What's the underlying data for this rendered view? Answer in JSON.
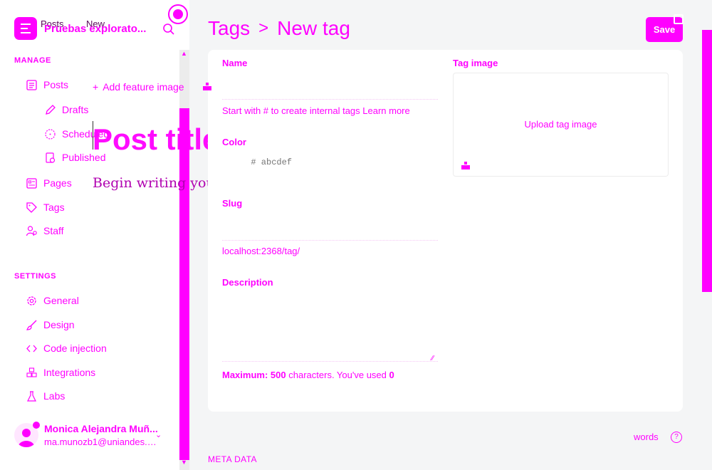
{
  "sidebar": {
    "site_title": "Pruebas explorato...",
    "ghost_tabs": {
      "posts": "Posts",
      "new": "New"
    },
    "manage_label": "MANAGE",
    "settings_label": "SETTINGS",
    "items": {
      "posts": "Posts",
      "drafts": "Drafts",
      "scheduled": "Scheduled",
      "published": "Published",
      "pages": "Pages",
      "tags": "Tags",
      "staff": "Staff",
      "general": "General",
      "design": "Design",
      "code_injection": "Code injection",
      "integrations": "Integrations",
      "labs": "Labs"
    },
    "user": {
      "name": "Monica Alejandra Muñ...",
      "email": "ma.munozb1@uniandes.e..."
    }
  },
  "editor_overlay": {
    "add_feature_image": "Add feature image",
    "post_title_placeholder": "Post title",
    "body_placeholder": "Begin writing your post..."
  },
  "header": {
    "breadcrumb_parent": "Tags",
    "breadcrumb_separator": ">",
    "breadcrumb_current": "New tag",
    "save_label": "Save"
  },
  "form": {
    "name_label": "Name",
    "name_help": "Start with # to create internal tags Learn more",
    "color_label": "Color",
    "color_placeholder": "# abcdef",
    "slug_label": "Slug",
    "slug_help": "localhost:2368/tag/",
    "description_label": "Description",
    "description_help_prefix": "Maximum:",
    "description_max": "500",
    "description_help_mid": "characters. You've used",
    "description_used": "0",
    "tag_image_label": "Tag image",
    "upload_label": "Upload tag image"
  },
  "footer": {
    "words_label": "words",
    "help_icon": "?",
    "meta_data_label": "META DATA"
  },
  "colors": {
    "accent": "#ff00ff",
    "background": "#f4f5f6",
    "panel": "#ffffff"
  }
}
